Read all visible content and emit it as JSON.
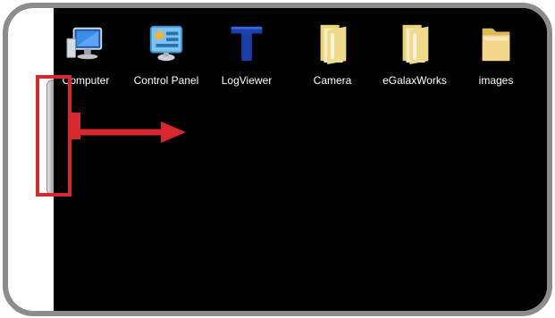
{
  "desktop": {
    "icons": [
      {
        "label": "Computer",
        "icon": "computer-icon"
      },
      {
        "label": "Control Panel",
        "icon": "control-panel-icon"
      },
      {
        "label": "LogViewer",
        "icon": "logviewer-icon"
      },
      {
        "label": "Camera",
        "icon": "folder-icon"
      },
      {
        "label": "eGalaxWorks",
        "icon": "folder-icon"
      },
      {
        "label": "images",
        "icon": "folder-icon"
      }
    ]
  },
  "annotation": {
    "highlight_color": "#d6282e",
    "arrow_direction": "right"
  },
  "colors": {
    "desktop_background": "#000000",
    "frame_bezel": "#8c8c8c",
    "side_panel": "#ffffff"
  }
}
